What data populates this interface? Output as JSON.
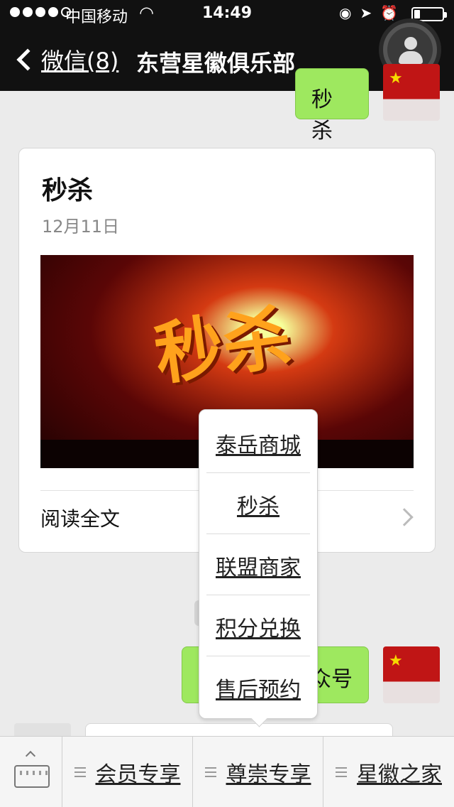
{
  "status_bar": {
    "carrier": "中国移动",
    "time": "14:49",
    "battery_level": 0.22
  },
  "nav": {
    "back_label": "微信(8)",
    "title": "东营星徽俱乐部"
  },
  "chat": {
    "top_bubble_text": "秒杀",
    "article": {
      "title": "秒杀",
      "date": "12月11日",
      "image_text": "秒杀",
      "read_all": "阅读全文"
    },
    "bottom_bubble_text": "众号"
  },
  "popup_menu": {
    "items": [
      "泰岳商城",
      "秒杀",
      "联盟商家",
      "积分兑换",
      "售后预约"
    ]
  },
  "bottom_menu": {
    "items": [
      "会员专享",
      "尊崇专享",
      "星徽之家"
    ]
  },
  "colors": {
    "bubble_green": "#9ee85f",
    "nav_background": "#111111"
  }
}
